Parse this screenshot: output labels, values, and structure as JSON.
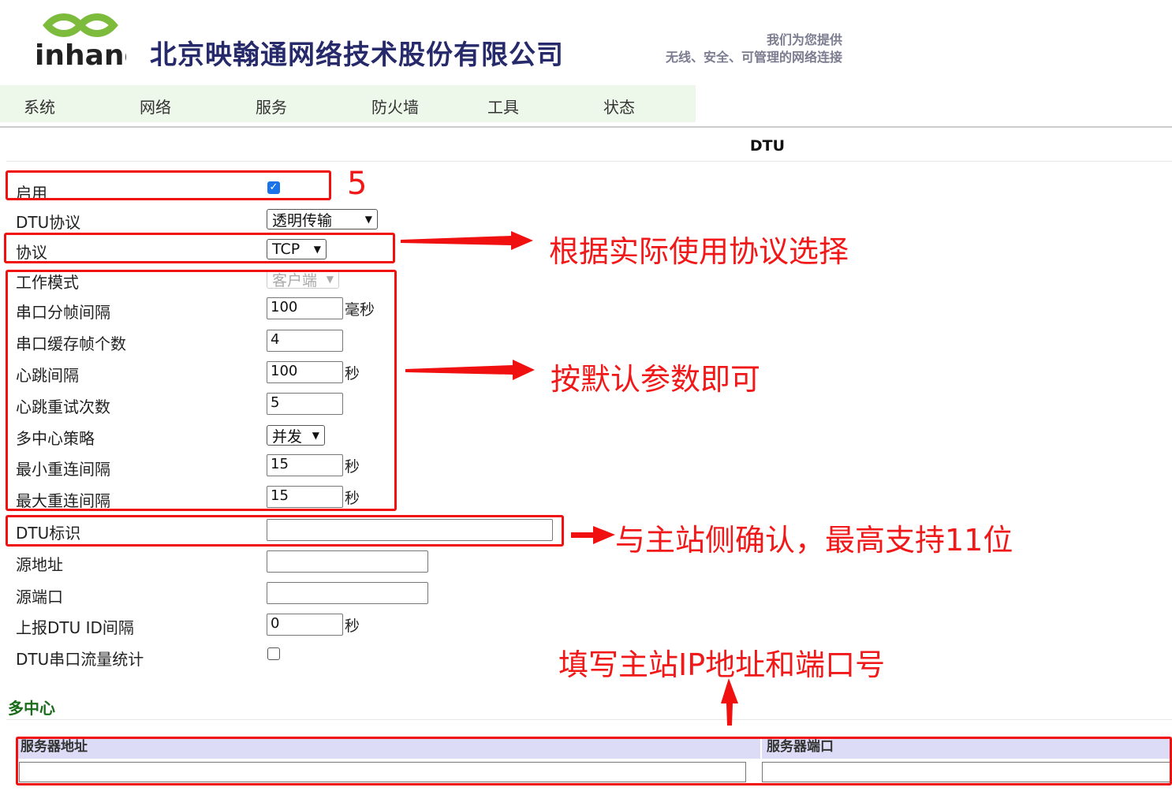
{
  "header": {
    "logo_text": "inhand",
    "company_name": "北京映翰通网络技术股份有限公司",
    "slogan_line1": "我们为您提供",
    "slogan_line2": "无线、安全、可管理的网络连接"
  },
  "nav": {
    "items": [
      "系统",
      "网络",
      "服务",
      "防火墙",
      "工具",
      "状态"
    ]
  },
  "page_title": "DTU",
  "form": {
    "enable": {
      "label": "启用",
      "checked": true
    },
    "dtu_protocol": {
      "label": "DTU协议",
      "value": "透明传输"
    },
    "protocol": {
      "label": "协议",
      "value": "TCP"
    },
    "work_mode": {
      "label": "工作模式",
      "value": "客户端"
    },
    "frame_interval": {
      "label": "串口分帧间隔",
      "value": "100",
      "unit": "毫秒"
    },
    "cache_frames": {
      "label": "串口缓存帧个数",
      "value": "4"
    },
    "heartbeat_interval": {
      "label": "心跳间隔",
      "value": "100",
      "unit": "秒"
    },
    "heartbeat_retries": {
      "label": "心跳重试次数",
      "value": "5"
    },
    "multicenter_policy": {
      "label": "多中心策略",
      "value": "并发"
    },
    "min_reconnect": {
      "label": "最小重连间隔",
      "value": "15",
      "unit": "秒"
    },
    "max_reconnect": {
      "label": "最大重连间隔",
      "value": "15",
      "unit": "秒"
    },
    "dtu_id": {
      "label": "DTU标识",
      "value": ""
    },
    "source_address": {
      "label": "源地址",
      "value": ""
    },
    "source_port": {
      "label": "源端口",
      "value": ""
    },
    "report_interval": {
      "label": "上报DTU ID间隔",
      "value": "0",
      "unit": "秒"
    },
    "traffic_stats": {
      "label": "DTU串口流量统计",
      "checked": false
    }
  },
  "multicenter": {
    "title": "多中心",
    "col_server_address": "服务器地址",
    "col_server_port": "服务器端口"
  },
  "annotations": {
    "step_number": "5",
    "protocol_note": "根据实际使用协议选择",
    "defaults_note": "按默认参数即可",
    "dtu_id_note": "与主站侧确认，最高支持11位",
    "server_note": "填写主站IP地址和端口号"
  },
  "colors": {
    "annotation_red": "#f01010",
    "nav_bg": "#edf7ea",
    "company_text": "#26296a",
    "table_header_bg": "#dcdcf6",
    "section_title_green": "#1a6b1a"
  }
}
